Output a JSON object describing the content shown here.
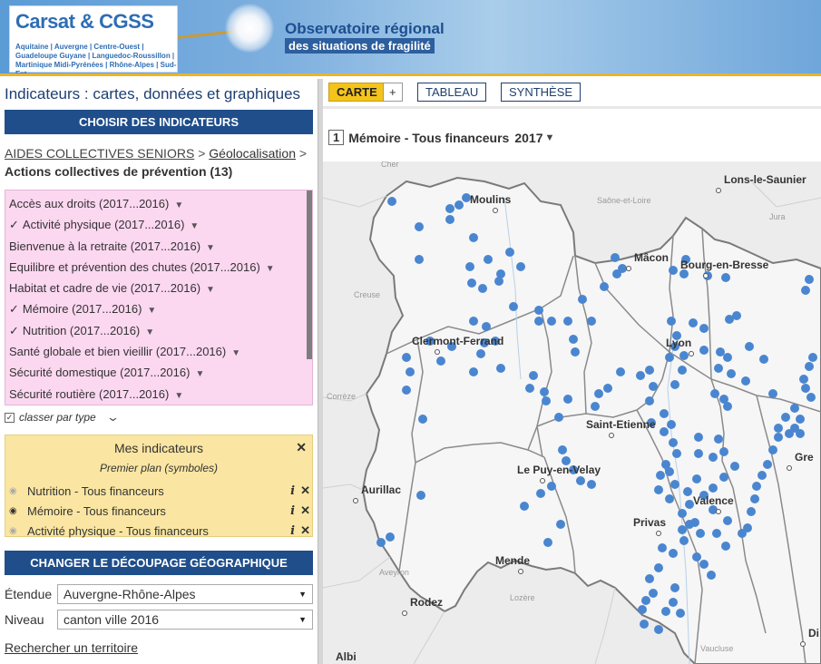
{
  "header": {
    "logo_text": "Carsat & CGSS",
    "logo_regions": "Aquitaine | Auvergne | Centre-Ouest | Guadeloupe Guyane | Languedoc-Roussillon | Martinique Midi-Pyrénées | Rhône-Alpes | Sud-Est",
    "title_line1": "Observatoire régional",
    "title_line2": "des situations de fragilité"
  },
  "left": {
    "title": "Indicateurs : cartes, données et graphiques",
    "choose_bar": "CHOISIR DES INDICATEURS",
    "breadcrumb": {
      "root": "AIDES COLLECTIVES SENIORS",
      "level2": "Géolocalisation",
      "current": "Actions collectives de prévention (13)"
    },
    "indicators": [
      {
        "label": "Accès aux droits (2017...2016)",
        "checked": false
      },
      {
        "label": "Activité physique (2017...2016)",
        "checked": true
      },
      {
        "label": "Bienvenue à la retraite (2017...2016)",
        "checked": false
      },
      {
        "label": "Equilibre et prévention des chutes (2017...2016)",
        "checked": false
      },
      {
        "label": "Habitat et cadre de vie (2017...2016)",
        "checked": false
      },
      {
        "label": "Mémoire (2017...2016)",
        "checked": true
      },
      {
        "label": "Nutrition (2017...2016)",
        "checked": true
      },
      {
        "label": "Santé globale et bien vieillir (2017...2016)",
        "checked": false
      },
      {
        "label": "Sécurité domestique (2017...2016)",
        "checked": false
      },
      {
        "label": "Sécurité routière (2017...2016)",
        "checked": false
      }
    ],
    "check_mark": "✓",
    "dropdown_glyph": "▼",
    "classer_label": "classer par type",
    "mes": {
      "title": "Mes indicateurs",
      "subtitle": "Premier plan (symboles)",
      "items": [
        {
          "label": "Nutrition - Tous financeurs",
          "visible": false
        },
        {
          "label": "Mémoire - Tous financeurs",
          "visible": true
        },
        {
          "label": "Activité physique - Tous financeurs",
          "visible": false
        }
      ]
    },
    "change_bar": "CHANGER LE DÉCOUPAGE GÉOGRAPHIQUE",
    "etendue_label": "Étendue",
    "etendue_value": "Auvergne-Rhône-Alpes",
    "niveau_label": "Niveau",
    "niveau_value": "canton ville 2016",
    "search_link": "Rechercher un territoire"
  },
  "right": {
    "tabs": {
      "carte": "CARTE",
      "plus": "+",
      "tableau": "TABLEAU",
      "synthese": "SYNTHÈSE"
    },
    "map_title": {
      "num": "1",
      "label": "Mémoire - Tous financeurs",
      "year": "2017",
      "arrow": "▼"
    },
    "map": {
      "cities": [
        "Moulins",
        "Mâcon",
        "Bourg-en-Bresse",
        "Lons-le-Saunier",
        "Clermont-Ferrand",
        "Lyon",
        "Saint-Etienne",
        "Le Puy-en-Velay",
        "Aurillac",
        "Valence",
        "Privas",
        "Mende",
        "Rodez",
        "Gre",
        "Albi",
        "Di"
      ],
      "light_labels": [
        "Cher",
        "Saône-et-Loire",
        "Jura",
        "Creuse",
        "Corrèze",
        "Lozère",
        "Aveyron",
        "Vaucluse"
      ],
      "point_color": "#4a86d0"
    }
  }
}
